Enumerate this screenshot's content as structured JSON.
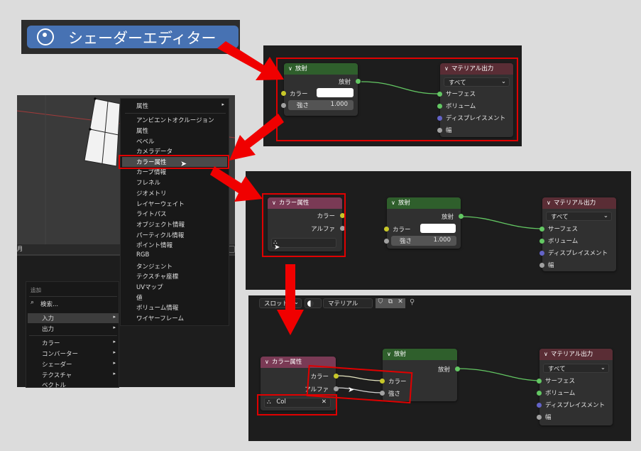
{
  "header_banner": {
    "title": "シェーダーエディター"
  },
  "node_common": {
    "emission": "放射",
    "material_output": "マテリアル出力",
    "color_attribute": "カラー属性",
    "color": "カラー",
    "alpha": "アルファ",
    "strength": "強さ",
    "strength_value": "1.000",
    "target_all": "すべて",
    "surface": "サーフェス",
    "volume": "ボリューム",
    "displacement": "ディスプレイスメント",
    "width": "幅",
    "color_attr_value": "Col"
  },
  "add_menu": {
    "section_label": "追加",
    "search": "検索...",
    "items": [
      "入力",
      "出力",
      "カラー",
      "コンバーター",
      "シェーダー",
      "テクスチャ",
      "ベクトル"
    ]
  },
  "input_submenu": {
    "items": [
      "属性",
      "アンビエントオクルージョン",
      "属性",
      "ベベル",
      "カメラデータ",
      "カラー属性",
      "カーブ情報",
      "フレネル",
      "ジオメトリ",
      "レイヤーウェイト",
      "ライトパス",
      "オブジェクト情報",
      "パーティクル情報",
      "ポイント情報",
      "RGB",
      "タンジェント",
      "テクスチャ座標",
      "UVマップ",
      "値",
      "ボリューム情報",
      "ワイヤーフレーム"
    ]
  },
  "viewport_header": {
    "mode_char": "月"
  },
  "header_bar": {
    "slot": "スロット",
    "material": "マテリアル"
  },
  "colors": {
    "highlight": "#e00000",
    "arrow": "#f00000",
    "emission_header": "#2f5f2c",
    "output_header": "#5a2d35",
    "attr_header": "#7a3a55"
  }
}
